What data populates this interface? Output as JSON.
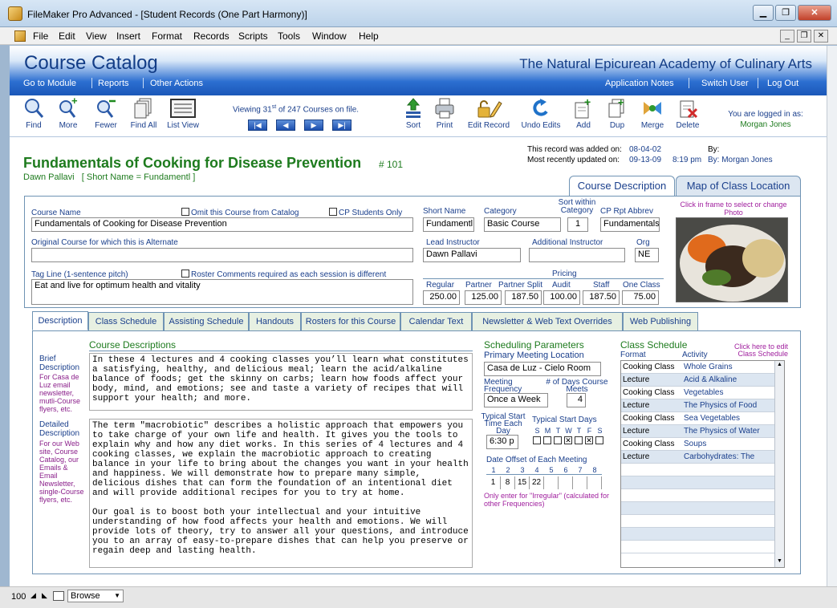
{
  "window": {
    "title": "FileMaker Pro Advanced - [Student Records (One Part Harmony)]",
    "minimize_label": "▁",
    "restore_label": "❐",
    "close_label": "✕"
  },
  "menu": [
    "File",
    "Edit",
    "View",
    "Insert",
    "Format",
    "Records",
    "Scripts",
    "Tools",
    "Window",
    "Help"
  ],
  "mdi_controls": [
    "_",
    "❐",
    "✕"
  ],
  "header": {
    "title": "Course Catalog",
    "school": "The Natural Epicurean Academy of Culinary Arts",
    "nav_left": [
      "Go to Module",
      "Reports",
      "Other Actions"
    ],
    "nav_right": [
      "Application Notes",
      "Switch User",
      "Log Out"
    ]
  },
  "toolbar": {
    "buttons_left": [
      {
        "label": "Find",
        "icon": "magnifier-icon"
      },
      {
        "label": "More",
        "icon": "magnifier-plus-icon"
      },
      {
        "label": "Fewer",
        "icon": "magnifier-minus-icon"
      },
      {
        "label": "Find All",
        "icon": "stack-icon"
      },
      {
        "label": "List View",
        "icon": "list-view-icon"
      }
    ],
    "viewing_prefix": "Viewing",
    "viewing_current": "31",
    "viewing_current_suffix": "st",
    "viewing_of": "of",
    "viewing_total": "247",
    "viewing_suffix": "Courses on file.",
    "nav_buttons": [
      "|◀",
      "◀",
      "▶",
      "▶|"
    ],
    "buttons_right": [
      {
        "label": "Sort",
        "icon": "sort-icon"
      },
      {
        "label": "Print",
        "icon": "printer-icon"
      },
      {
        "label": "Edit Record",
        "icon": "lock-pencil-icon"
      },
      {
        "label": "Undo Edits",
        "icon": "undo-icon"
      },
      {
        "label": "Add",
        "icon": "add-record-icon"
      },
      {
        "label": "Dup",
        "icon": "duplicate-icon"
      },
      {
        "label": "Merge",
        "icon": "merge-icon"
      },
      {
        "label": "Delete",
        "icon": "delete-icon"
      }
    ],
    "logged_in_label": "You are logged in as:",
    "logged_in_user": "Morgan Jones"
  },
  "record": {
    "course_title": "Fundamentals of Cooking for Disease Prevention",
    "course_number": "# 101",
    "instructor_line": "Dawn Pallavi   [ Short Name = Fundamentl ]",
    "added_label": "This record was added on:",
    "added_date": "08-04-02",
    "updated_label": "Most recently updated on:",
    "updated_date": "09-13-09",
    "updated_time": "8:19 pm",
    "by_label": "By:",
    "updated_by": "By: Morgan Jones"
  },
  "top_tabs": [
    "Course Description",
    "Map of Class Location"
  ],
  "fields": {
    "course_name_label": "Course Name",
    "course_name": "Fundamentals of Cooking for Disease Prevention",
    "omit_label": "Omit this Course from Catalog",
    "cp_students_label": "CP Students Only",
    "short_name_label": "Short Name",
    "short_name": "Fundamentl",
    "category_label": "Category",
    "category": "Basic Course",
    "sort_within_label": "Sort within Category",
    "sort_within": "1",
    "cp_rpt_label": "CP Rpt Abbrev",
    "cp_rpt": "Fundamentals",
    "original_course_label": "Original Course for which this is Alternate",
    "original_course": "",
    "lead_instructor_label": "Lead Instructor",
    "lead_instructor": "Dawn Pallavi",
    "additional_instructor_label": "Additional Instructor",
    "additional_instructor": "",
    "org_label": "Org",
    "org": "NE",
    "tag_line_label": "Tag Line  (1-sentence pitch)",
    "roster_comments_label": "Roster Comments required as each session is different",
    "tag_line": "Eat and live for optimum health and vitality",
    "photo_hint": "Click in frame to select or change Photo"
  },
  "pricing": {
    "label": "Pricing",
    "columns": [
      "Regular",
      "Partner",
      "Partner Split",
      "Audit",
      "Staff",
      "One Class"
    ],
    "values": [
      "250.00",
      "125.00",
      "187.50",
      "100.00",
      "187.50",
      "75.00"
    ]
  },
  "sub_tabs": [
    "Description",
    "Class Schedule",
    "Assisting Schedule",
    "Handouts",
    "Rosters for this Course",
    "Calendar Text",
    "Newsletter & Web Text Overrides",
    "Web Publishing"
  ],
  "descriptions": {
    "heading": "Course Descriptions",
    "brief_label": "Brief Description",
    "brief_note": "For Casa de Luz email newsletter, mutli-Course flyers, etc.",
    "brief_text": "In these 4 lectures and 4 cooking classes you’ll learn what constitutes a satisfying, healthy, and delicious meal; learn the acid/alkaline balance of foods; get the skinny on carbs; learn how foods affect your body, mind, and emotions; see and taste a variety of recipes that will support your health; and more.",
    "detailed_label": "Detailed Description",
    "detailed_note": "For our Web site, Course Catalog, our Emails & Email Newsletter, single-Course flyers, etc.",
    "detailed_text": "The term \"macrobiotic\" describes a holistic approach that empowers you to take charge of your own life and health. It gives you the tools to explain why and how any diet works. In this series of 4 lectures and 4 cooking classes, we explain the macrobiotic approach to creating balance in your life to bring about the changes you want in your health and happiness. We will demonstrate how to prepare many simple, delicious dishes that can form the foundation of an intentional diet and will provide additional recipes for you to try at home.\n\nOur goal is to boost both your intellectual and your intuitive understanding of how food affects your health and emotions. We will provide lots of theory, try to answer all your questions, and introduce you to an array of easy-to-prepare dishes that can help you preserve or regain deep and lasting health."
  },
  "scheduling": {
    "heading": "Scheduling Parameters",
    "location_label": "Primary Meeting Location",
    "location": "Casa de Luz - Cielo Room",
    "frequency_label": "Meeting Frequency",
    "frequency": "Once a Week",
    "days_label": "# of Days Course Meets",
    "days": "4",
    "start_time_label": "Typical Start Time Each Day",
    "start_time": "6:30 p",
    "start_days_label": "Typical Start Days",
    "day_letters": [
      "S",
      "M",
      "T",
      "W",
      "T",
      "F",
      "S"
    ],
    "day_checked": [
      false,
      false,
      false,
      true,
      false,
      true,
      false
    ],
    "offset_label": "Date Offset of Each Meeting",
    "offset_headers": [
      "1",
      "2",
      "3",
      "4",
      "5",
      "6",
      "7",
      "8"
    ],
    "offset_values": [
      "1",
      "8",
      "15",
      "22",
      "",
      "",
      "",
      ""
    ],
    "irregular_note": "Only enter for \"Irregular\" (calculated for other Frequencies)"
  },
  "class_schedule": {
    "heading": "Class Schedule",
    "edit_hint": "Click here to edit Class Schedule",
    "format_label": "Format",
    "activity_label": "Activity",
    "rows": [
      {
        "format": "Cooking Class",
        "activity": "Whole Grains"
      },
      {
        "format": "Lecture",
        "activity": "Acid & Alkaline"
      },
      {
        "format": "Cooking Class",
        "activity": "Vegetables"
      },
      {
        "format": "Lecture",
        "activity": "The Physics of Food"
      },
      {
        "format": "Cooking Class",
        "activity": "Sea Vegetables"
      },
      {
        "format": "Lecture",
        "activity": "The Physics of Water"
      },
      {
        "format": "Cooking Class",
        "activity": "Soups"
      },
      {
        "format": "Lecture",
        "activity": "Carbohydrates: The"
      },
      {
        "format": "",
        "activity": ""
      },
      {
        "format": "",
        "activity": ""
      },
      {
        "format": "",
        "activity": ""
      },
      {
        "format": "",
        "activity": ""
      },
      {
        "format": "",
        "activity": ""
      },
      {
        "format": "",
        "activity": ""
      },
      {
        "format": "",
        "activity": ""
      }
    ]
  },
  "statusbar": {
    "zoom": "100",
    "mode": "Browse"
  }
}
